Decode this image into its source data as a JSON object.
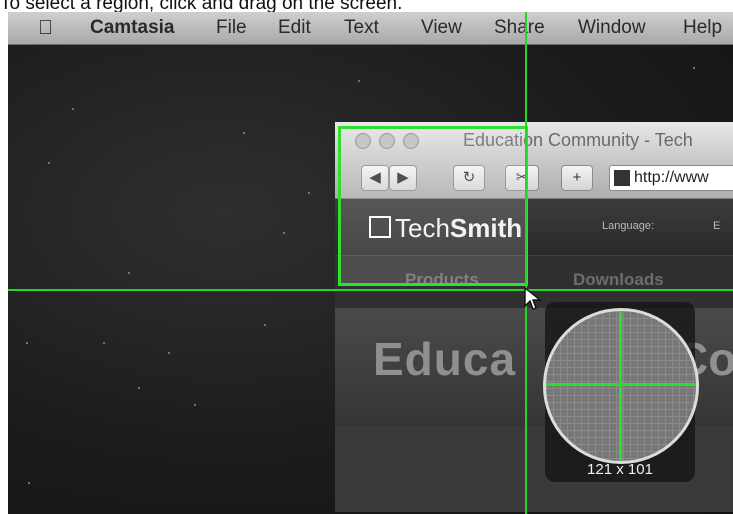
{
  "caption": "To select a region, click and drag on the screen.",
  "menubar": {
    "apple_icon": "apple-logo",
    "items": [
      "Camtasia",
      "File",
      "Edit",
      "Text",
      "View",
      "Share",
      "Window",
      "Help"
    ]
  },
  "browser": {
    "title": "Education Community - Tech",
    "toolbar": {
      "back": "◀",
      "forward": "▶",
      "reload": "↻",
      "snip": "✂",
      "add": "+",
      "url": "http://www"
    },
    "site": {
      "logo_prefix": "Tech",
      "logo_bold": "Smith",
      "language_label": "Language:",
      "language_value": "E",
      "nav": [
        "Products",
        "Downloads"
      ],
      "hero_text": "Educa",
      "hero_text_right": "Co"
    }
  },
  "selection": {
    "color": "#2fe02f",
    "dimensions": "121 x 101"
  }
}
